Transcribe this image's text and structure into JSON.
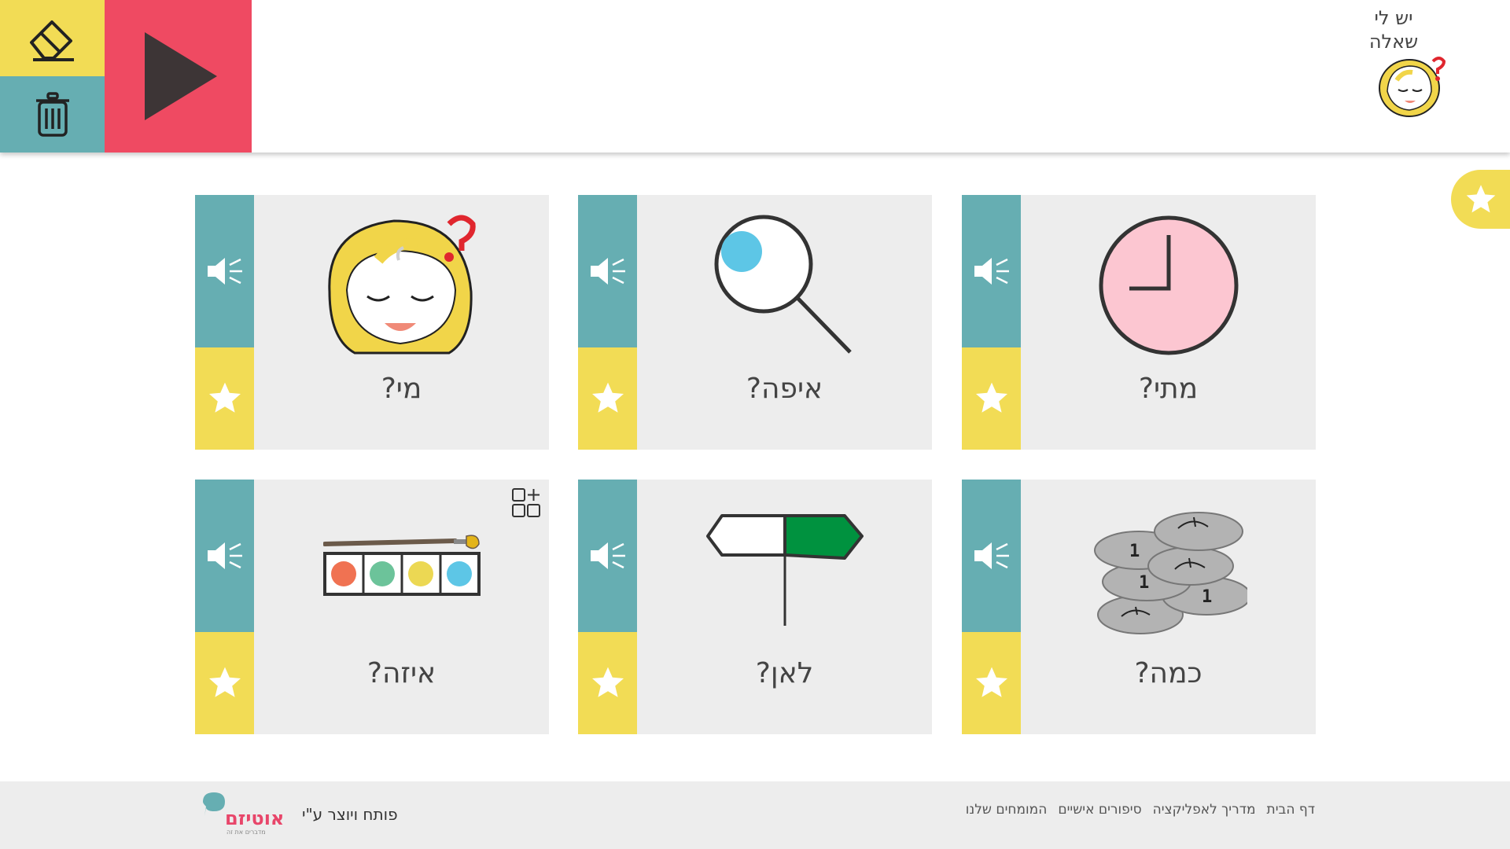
{
  "header": {
    "title_line1": "יש לי",
    "title_line2": "שאלה"
  },
  "icons": {
    "eraser": "eraser-icon",
    "trash": "trash-icon",
    "play": "play-icon",
    "speaker": "speaker-icon",
    "star": "star-icon",
    "add_grid": "grid-plus-icon"
  },
  "colors": {
    "yellow": "#f2dc55",
    "teal": "#66aeb2",
    "red": "#ef4a62",
    "card_bg": "#ededed"
  },
  "cards": [
    {
      "label": "מתי?",
      "image": "clock"
    },
    {
      "label": "איפה?",
      "image": "magnifier"
    },
    {
      "label": "מי?",
      "image": "girl-face"
    },
    {
      "label": "כמה?",
      "image": "coins"
    },
    {
      "label": "לאן?",
      "image": "signpost"
    },
    {
      "label": "איזה?",
      "image": "paint-palette"
    }
  ],
  "footer": {
    "links": [
      "דף הבית",
      "מדריך לאפליקציה",
      "סיפורים אישיים",
      "המומחים שלנו"
    ],
    "credit": "פותח ויוצר ע\"י",
    "logo_word": "אוטיזם",
    "logo_tagline": "מדברים את זה"
  }
}
